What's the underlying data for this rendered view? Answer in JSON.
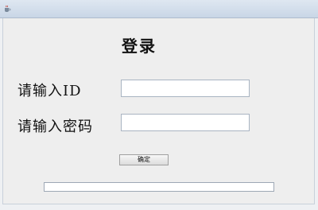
{
  "window": {
    "app_icon": "java-cup-icon"
  },
  "form": {
    "title": "登录",
    "id_label": "请输入ID",
    "id_value": "",
    "password_label": "请输入密码",
    "password_value": "",
    "confirm_label": "确定"
  },
  "progress": {
    "fraction": 0
  }
}
